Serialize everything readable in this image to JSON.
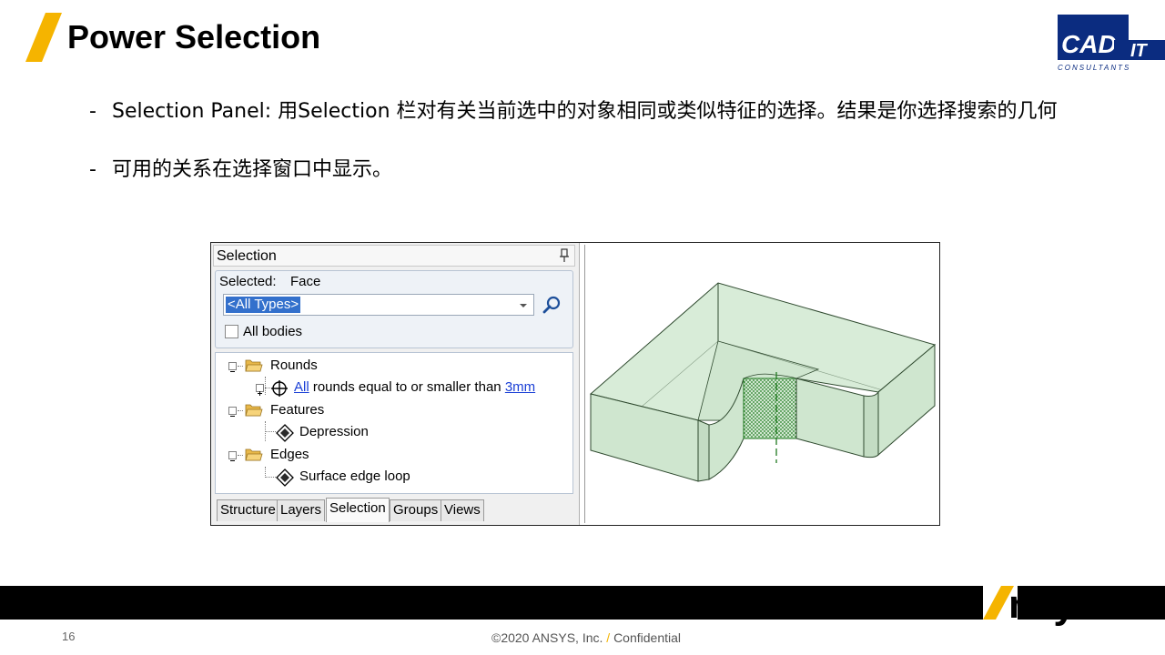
{
  "slide": {
    "title": "Power Selection",
    "accent_color": "#f5b400",
    "bullets": [
      {
        "dash": "-",
        "text": "Selection Panel: 用Selection 栏对有关当前选中的对象相同或类似特征的选择。结果是你选择搜索的几何"
      },
      {
        "dash": "-",
        "text": "可用的关系在选择窗口中显示。"
      }
    ],
    "logo": {
      "main": "CAD",
      "suffix": "IT",
      "sub": "CONSULTANTS",
      "color": "#0b2c80"
    }
  },
  "panel": {
    "title": "Selection",
    "selected_label": "Selected:",
    "selected_value": "Face",
    "type_filter": "<All Types>",
    "all_bodies_label": "All bodies",
    "all_bodies_checked": false,
    "tree": {
      "rounds": {
        "label": "Rounds",
        "item_link": "All",
        "item_text": "rounds equal to or smaller than",
        "item_value": "3mm"
      },
      "features": {
        "label": "Features",
        "item": "Depression"
      },
      "edges": {
        "label": "Edges",
        "item": "Surface edge loop"
      }
    },
    "tabs": [
      "Structure",
      "Layers",
      "Selection",
      "Groups",
      "Views"
    ],
    "active_tab": "Selection"
  },
  "viewport": {
    "body_color": "#d4ead4",
    "edge_color": "#2f4a2f",
    "highlight_color": "#1f7a1f"
  },
  "footer": {
    "page_number": "16",
    "copyright": "©2020 ANSYS, Inc.",
    "separator": "/",
    "confidential": "Confidential",
    "brand": "nsys"
  }
}
